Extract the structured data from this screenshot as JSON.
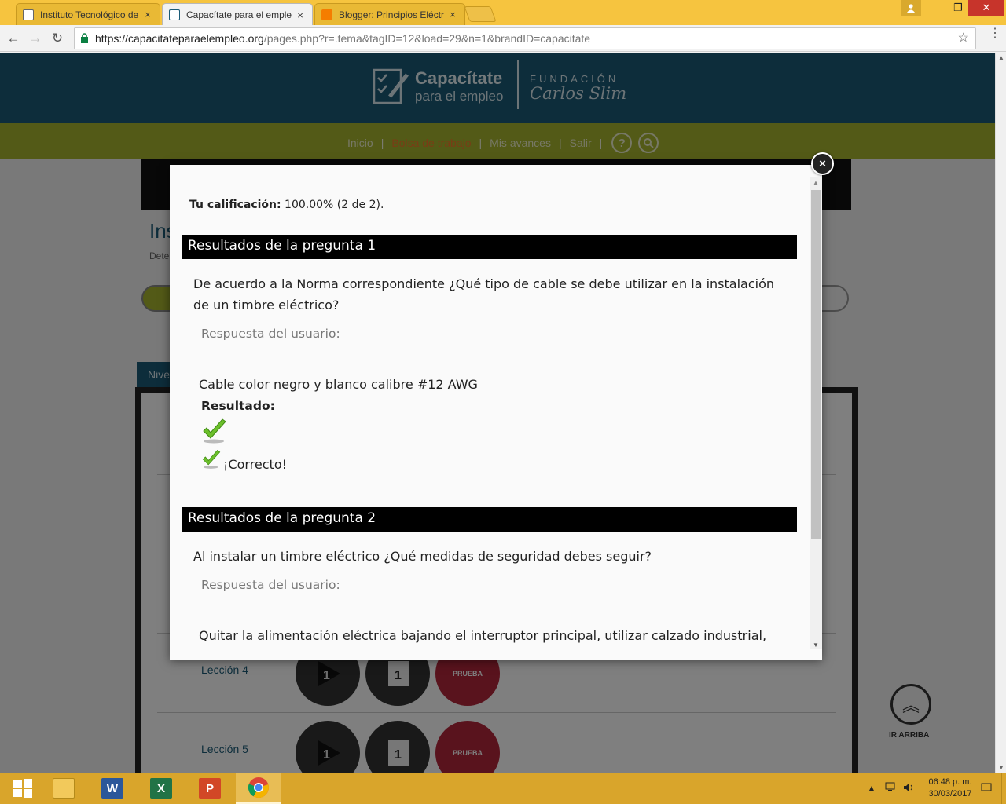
{
  "browser": {
    "tabs": [
      {
        "title": "Instituto Tecnológico de",
        "close": "×"
      },
      {
        "title": "Capacítate para el emple",
        "close": "×"
      },
      {
        "title": "Blogger: Principios Eléctr",
        "close": "×"
      }
    ],
    "url_host": "https://capacitateparaelempleo.org",
    "url_path": "/pages.php?r=.tema&tagID=12&load=29&n=1&brandID=capacitate",
    "star": "☆",
    "back": "←",
    "forward": "→",
    "reload": "↻",
    "menu": "⋮",
    "window": {
      "minimize": "—",
      "maximize": "❐",
      "close": "✕"
    }
  },
  "site": {
    "logo_name": "Capacítate",
    "logo_sub": "para el empleo",
    "fundacion": "FUNDACIÓN",
    "carlos_slim": "Carlos Slim",
    "nav": [
      "Inicio",
      "Bolsa de trabajo",
      "Mis avances",
      "Salir"
    ],
    "nav_sep": "|",
    "help_icon": "?",
    "page_title": "Ins",
    "page_sub": "Dete",
    "level_tab": "Nive",
    "lessons": [
      "Lección 4",
      "Lección 5"
    ],
    "round_play": "1",
    "round_book": "1",
    "test_label": "PRUEBA",
    "up_arrow": "︽",
    "up_label": "IR ARRIBA"
  },
  "modal": {
    "score_label": "Tu calificación:",
    "score_value": " 100.00% (2 de 2).",
    "close": "×",
    "questions": [
      {
        "header": "Resultados de la pregunta 1",
        "text": "De acuerdo a la Norma correspondiente ¿Qué tipo de cable se debe utilizar en la instalación de un timbre eléctrico?",
        "resp_label": "Respuesta del usuario:",
        "answer": "Cable color negro y blanco calibre #12 AWG",
        "result_label": "Resultado:",
        "correct": "¡Correcto!"
      },
      {
        "header": "Resultados de la pregunta 2",
        "text": "Al instalar un timbre eléctrico ¿Qué medidas de seguridad debes seguir?",
        "resp_label": "Respuesta del usuario:",
        "answer": "Quitar la alimentación eléctrica bajando el interruptor principal, utilizar calzado industrial,"
      }
    ]
  },
  "taskbar": {
    "clock_time": "06:48 p. m.",
    "clock_date": "30/03/2017",
    "tray_up": "▲",
    "word": "W",
    "excel": "X",
    "ppt": "P"
  },
  "colors": {
    "header": "#1a5b77",
    "nav": "#a6b42e",
    "tabstrip": "#f6c43f",
    "taskbar": "#d9a52b",
    "accent_orange": "#f07a2a",
    "check_green": "#6bbf2a"
  }
}
